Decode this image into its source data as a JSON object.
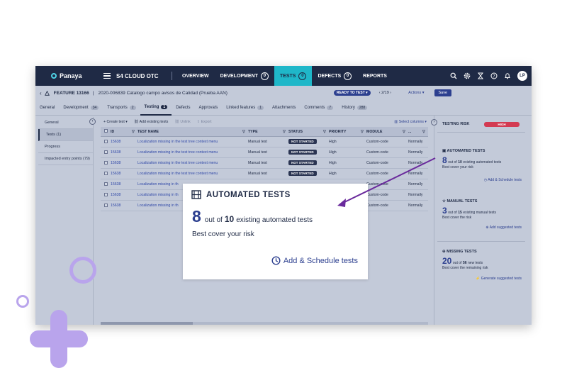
{
  "nav": {
    "logo": "Panaya",
    "project": "S4 CLOUD OTC",
    "items": [
      {
        "label": "OVERVIEW",
        "count": ""
      },
      {
        "label": "DEVELOPMENT",
        "count": "0"
      },
      {
        "label": "TESTS",
        "count": "0"
      },
      {
        "label": "DEFECTS",
        "count": "0"
      },
      {
        "label": "REPORTS",
        "count": ""
      }
    ],
    "active_item": "TESTS",
    "user_initials": "LP"
  },
  "feature": {
    "id": "FEATURE 13166",
    "title": "2020-006839 Catalogo campo avisos de Calidad (Prueba AAN)",
    "status": "READY TO TEST",
    "pager": "2/19",
    "actions_label": "Actions",
    "save_label": "Save"
  },
  "tabs": [
    {
      "label": "General",
      "badge": ""
    },
    {
      "label": "Development",
      "badge": "34"
    },
    {
      "label": "Transports",
      "badge": "2"
    },
    {
      "label": "Testing",
      "badge": "1"
    },
    {
      "label": "Defects",
      "badge": ""
    },
    {
      "label": "Approvals",
      "badge": ""
    },
    {
      "label": "Linked features",
      "badge": "1"
    },
    {
      "label": "Attachments",
      "badge": ""
    },
    {
      "label": "Comments",
      "badge": "7"
    },
    {
      "label": "History",
      "badge": "288"
    }
  ],
  "left_menu": [
    "General",
    "Tests (1)",
    "Progress",
    "Impacted entry points (79)"
  ],
  "toolbar": {
    "create": "+ Create test",
    "add_existing": "Add existing tests",
    "unlink": "Unlink",
    "export": "Export",
    "select_columns": "Select columns"
  },
  "columns": [
    "ID",
    "TEST NAME",
    "TYPE",
    "STATUS",
    "PRIORITY",
    "MODULE",
    "..."
  ],
  "rows": [
    {
      "id": "15638",
      "name": "Localization missing in the test tree context menu",
      "type": "Manual test",
      "status": "NOT STARTED",
      "priority": "High",
      "module": "Custom-code",
      "extra": "Normally"
    },
    {
      "id": "15638",
      "name": "Localization missing in the test tree context menu",
      "type": "Manual test",
      "status": "NOT STARTED",
      "priority": "High",
      "module": "Custom-code",
      "extra": "Normally"
    },
    {
      "id": "15638",
      "name": "Localization missing in the test tree context menu",
      "type": "Manual test",
      "status": "NOT STARTED",
      "priority": "High",
      "module": "Custom-code",
      "extra": "Normally"
    },
    {
      "id": "15638",
      "name": "Localization missing in the test tree context menu",
      "type": "Manual test",
      "status": "NOT STARTED",
      "priority": "High",
      "module": "Custom-code",
      "extra": "Normally"
    },
    {
      "id": "15638",
      "name": "Localization missing in th",
      "type": "",
      "status": "",
      "priority": "",
      "module": "Custom-code",
      "extra": "Normally"
    },
    {
      "id": "15638",
      "name": "Localization missing in th",
      "type": "",
      "status": "",
      "priority": "",
      "module": "Custom-code",
      "extra": "Normally"
    },
    {
      "id": "15638",
      "name": "Localization missing in th",
      "type": "",
      "status": "",
      "priority": "",
      "module": "Custom-code",
      "extra": "Normally"
    }
  ],
  "risk": {
    "title": "TESTING RISK",
    "level": "HIGH",
    "automated": {
      "title": "AUTOMATED TESTS",
      "num": "8",
      "of": "out of",
      "total": "10",
      "suffix": "existing automated tests",
      "sub": "Best cover your risk",
      "action": "Add & Schedule tests"
    },
    "manual": {
      "title": "MANUAL TESTS",
      "num": "3",
      "of": "out of",
      "total": "15",
      "suffix": "existing manual tests",
      "sub": "Best cover the risk",
      "action": "Add suggested tests"
    },
    "missing": {
      "title": "MISSING TESTS",
      "num": "20",
      "of": "out of",
      "total": "56",
      "suffix": "new tests",
      "sub": "Best cover the remaining risk",
      "action": "Generate suggested tests"
    }
  },
  "callout": {
    "title": "AUTOMATED TESTS",
    "num": "8",
    "of": "out of",
    "total": "10",
    "suffix": "existing automated tests",
    "sub": "Best cover your risk",
    "action": "Add & Schedule tests"
  },
  "colors": {
    "nav_bg": "#1f2a45",
    "active_tab": "#1fb7c9",
    "accent": "#2c3f8f",
    "risk_high": "#d33a52",
    "deco": "#b9a4ec",
    "arrow": "#6a2a9c"
  }
}
